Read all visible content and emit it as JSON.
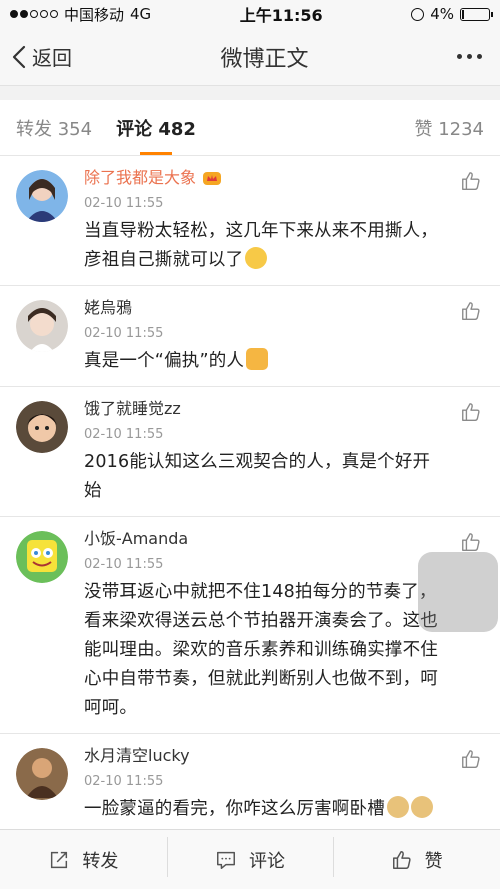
{
  "status_bar": {
    "carrier": "中国移动",
    "network": "4G",
    "time": "上午11:56",
    "battery": "4%"
  },
  "nav": {
    "back_label": "返回",
    "title": "微博正文"
  },
  "tabs": {
    "repost": "转发 354",
    "comment": "评论 482",
    "like": "赞 1234"
  },
  "comments": [
    {
      "name": "除了我都是大象",
      "time": "02-10 11:55",
      "text": "当直导粉太轻松，这几年下来从来不用撕人，彦祖自己撕就可以了"
    },
    {
      "name": "姥烏鴉",
      "time": "02-10 11:55",
      "text": "真是一个“偏执”的人"
    },
    {
      "name": "饿了就睡觉zz",
      "time": "02-10 11:55",
      "text": "2016能认知这么三观契合的人，真是个好开始"
    },
    {
      "name": "小饭-Amanda",
      "time": "02-10 11:55",
      "text": "没带耳返心中就把不住148拍每分的节奏了，看来梁欢得送云总个节拍器开演奏会了。这也能叫理由。梁欢的音乐素养和训练确实撑不住心中自带节奏，但就此判断别人也做不到，呵呵呵。"
    },
    {
      "name": "水月清空lucky",
      "time": "02-10 11:55",
      "text": "一脸蒙逼的看完，你咋这么厉害啊卧槽"
    }
  ],
  "toolbar": {
    "repost": "转发",
    "comment": "评论",
    "like": "赞"
  }
}
